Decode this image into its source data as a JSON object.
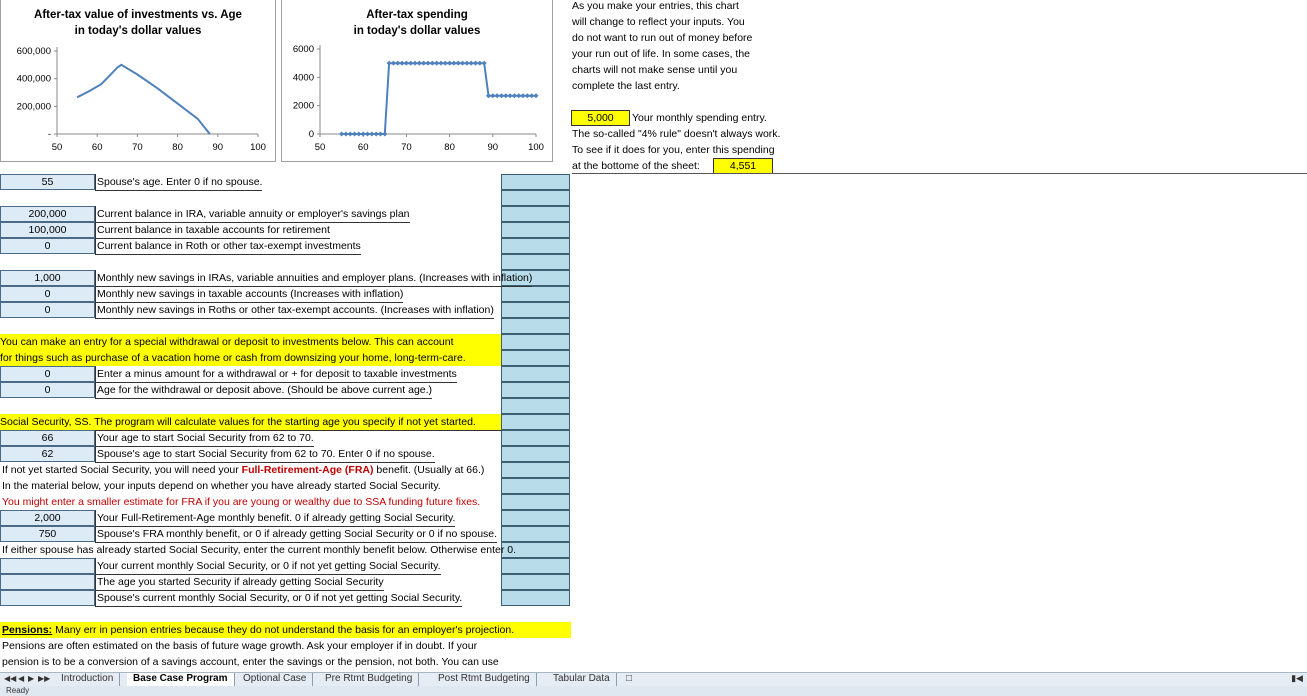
{
  "chart_data": [
    {
      "type": "line",
      "title": "After-tax value of investments vs. Age\nin today's dollar values",
      "xlim": [
        50,
        100
      ],
      "x_ticks": [
        "50",
        "60",
        "70",
        "80",
        "90",
        "100"
      ],
      "ylim": [
        0,
        600000
      ],
      "y_ticks": [
        "-",
        "200,000",
        "400,000",
        "600,000"
      ],
      "series": [
        {
          "x": [
            55,
            58,
            61,
            63,
            65,
            66,
            70,
            75,
            80,
            85,
            88
          ],
          "y": [
            265000,
            310000,
            360000,
            420000,
            480000,
            500000,
            430000,
            330000,
            220000,
            110000,
            0
          ]
        }
      ],
      "color": "#4f81bd"
    },
    {
      "type": "line",
      "title": "After-tax spending\nin today's dollar values",
      "xlim": [
        50,
        100
      ],
      "x_ticks": [
        "50",
        "60",
        "70",
        "80",
        "90",
        "100"
      ],
      "ylim": [
        0,
        6000
      ],
      "y_ticks": [
        "0",
        "2000",
        "4000",
        "6000"
      ],
      "series": [
        {
          "x": [
            55,
            56,
            57,
            58,
            59,
            60,
            61,
            62,
            63,
            64,
            65,
            66,
            67,
            68,
            69,
            70,
            71,
            72,
            73,
            74,
            75,
            76,
            77,
            78,
            79,
            80,
            81,
            82,
            83,
            84,
            85,
            86,
            87,
            88,
            89,
            90,
            91,
            92,
            93,
            94,
            95,
            96,
            97,
            98,
            99,
            100
          ],
          "y": [
            0,
            0,
            0,
            0,
            0,
            0,
            0,
            0,
            0,
            0,
            0,
            5000,
            5000,
            5000,
            5000,
            5000,
            5000,
            5000,
            5000,
            5000,
            5000,
            5000,
            5000,
            5000,
            5000,
            5000,
            5000,
            5000,
            5000,
            5000,
            5000,
            5000,
            5000,
            5000,
            2700,
            2700,
            2700,
            2700,
            2700,
            2700,
            2700,
            2700,
            2700,
            2700,
            2700,
            2700
          ]
        }
      ],
      "color": "#4f81bd"
    }
  ],
  "notes": {
    "line1": "As you make your entries, this chart",
    "line2": "will change to reflect your inputs.  You",
    "line3": "do not want to run out of money before",
    "line4": "your run out of life.  In some cases, the",
    "line5": "charts will not make sense until you",
    "line6": "complete the last entry.",
    "spending_value": "5,000",
    "spending_label": "Your monthly spending entry.",
    "rule_line1": "The so-called \"4% rule\" doesn't always work.",
    "rule_line2": "To see if it does for you, enter this spending",
    "rule_line3": "at the bottome of the sheet:",
    "rule_value": "4,551"
  },
  "rows": {
    "spouse_age_value": "55",
    "spouse_age_label": "Spouse's age.  Enter 0 if no spouse.",
    "ira_value": "200,000",
    "ira_label": "Current balance in IRA, variable annuity or employer's savings plan",
    "taxable_value": "100,000",
    "taxable_label": "Current balance in taxable accounts for retirement",
    "roth_value": "0",
    "roth_label": "Current balance in Roth or other tax-exempt investments",
    "monthly_ira_value": "1,000",
    "monthly_ira_label": "Monthly new savings in IRAs, variable annuities and employer plans.  (Increases with inflation)",
    "monthly_taxable_value": "0",
    "monthly_taxable_label": "Monthly new savings in taxable accounts (Increases with inflation)",
    "monthly_roth_value": "0",
    "monthly_roth_label": "Monthly new savings in Roths or other tax-exempt accounts.  (Increases with inflation)",
    "special_line1": "You can make an entry for a special withdrawal or deposit to investments below.  This can account",
    "special_line2": "for things such as purchase of a vacation home or cash from downsizing your home, long-term-care.",
    "withdrawal_value": "0",
    "withdrawal_label": "Enter a minus amount for a withdrawal or + for deposit to taxable investments",
    "withdrawal_age_value": "0",
    "withdrawal_age_label": "Age for the withdrawal or deposit above.  (Should be above current age.)",
    "ss_header": "Social Security, SS.  The program will calculate values for the starting age you specify if not yet started.",
    "ss_age_value": "66",
    "ss_age_label": "Your age to start Social Security from 62 to 70.",
    "ss_spouse_age_value": "62",
    "ss_spouse_age_label": "Spouse's age to start Social Security from 62 to 70. Enter 0 if no spouse.",
    "fra_line_a": "If not yet started Social Security, you will need your ",
    "fra_line_b": "Full-Retirement-Age (FRA)",
    "fra_line_c": " benefit.  (Usually at 66.)",
    "inputs_depend": "In the material below, your inputs depend on whether you have already started Social Security.",
    "smaller_estimate": "You might enter a smaller estimate for FRA if you are young or wealthy due to SSA funding future fixes.",
    "fra_value": "2,000",
    "fra_label": "Your Full-Retirement-Age monthly benefit.  0 if already getting Social Security.",
    "spouse_fra_value": "750",
    "spouse_fra_label": "Spouse's FRA monthly benefit, or 0 if already getting Social Security or 0 if no spouse.",
    "either_spouse": "If either spouse has already started Social Security, enter the current monthly benefit below.  Otherwise enter 0.",
    "current_ss_label": "Your current monthly Social Security, or 0 if not yet getting Social Security.",
    "age_started_label": "The age you started Security if already getting Social Security",
    "spouse_current_ss_label": "Spouse's current monthly Social Security, or 0 if not yet getting Social Security.",
    "pensions_title": "Pensions:",
    "pensions_line1": "  Many err in pension entries because they do not understand the basis for an employer's projection.",
    "pensions_line2": "Pensions are often estimated on the basis of future wage growth.  Ask your employer if in doubt.  If your",
    "pensions_line3": "pension is to be a conversion of a savings account,  enter the savings or the pension, not both.  You can use"
  },
  "sheet_tabs": [
    "Introduction",
    "Base Case Program",
    "Optional Case",
    "Pre Rtmt Budgeting",
    "Post Rtmt Budgeting",
    "Tabular Data"
  ],
  "active_tab": "Base Case Program",
  "status": "Ready"
}
